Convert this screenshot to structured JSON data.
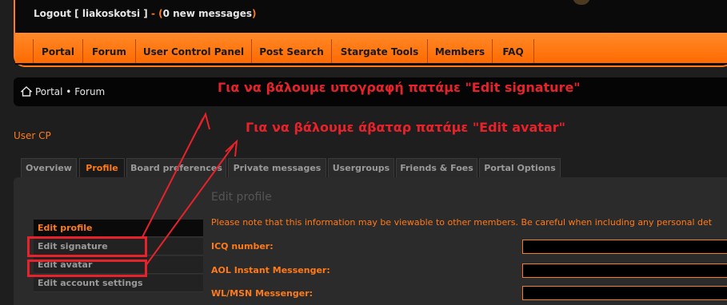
{
  "header": {
    "logout_prefix": "Logout [ liakoskotsi ]",
    "dash": " - ",
    "new_messages": "(0 new messages)"
  },
  "nav": [
    "Portal",
    "Forum",
    "User Control Panel",
    "Post Search",
    "Stargate Tools",
    "Members",
    "FAQ"
  ],
  "breadcrumb": {
    "portal": "Portal",
    "sep": " • ",
    "forum": "Forum"
  },
  "annotations": {
    "signature": "Για να βάλουμε υπογραφή πατάμε \"Edit signature\"",
    "avatar": "Για να βάλουμε άβαταρ πατάμε \"Edit avatar\""
  },
  "usercp_label": "User CP",
  "tabs": [
    "Overview",
    "Profile",
    "Board preferences",
    "Private messages",
    "Usergroups",
    "Friends & Foes",
    "Portal Options"
  ],
  "active_tab": "Profile",
  "menu": [
    "Edit profile",
    "Edit signature",
    "Edit avatar",
    "Edit account settings"
  ],
  "main": {
    "title": "Edit profile",
    "note": "Please note that this information may be viewable to other members. Be careful when including any personal det",
    "fields": [
      "ICQ number:",
      "AOL Instant Messenger:",
      "WL/MSN Messenger:"
    ]
  },
  "colors": {
    "accent": "#ff7a1a",
    "annotation": "#e8222a",
    "background": "#1e1e1e"
  }
}
